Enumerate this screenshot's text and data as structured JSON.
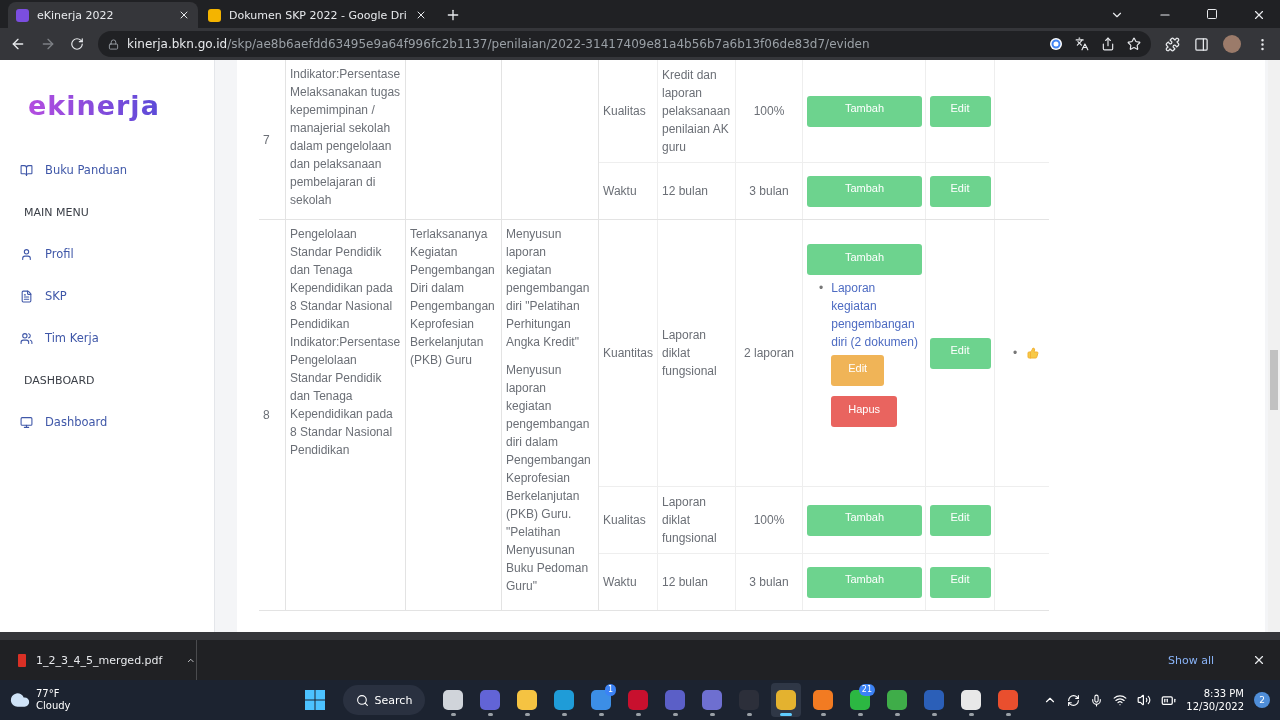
{
  "browser": {
    "tabs": [
      {
        "title": "eKinerja 2022",
        "selected": true
      },
      {
        "title": "Dokumen SKP 2022 - Google Dri",
        "selected": false
      }
    ],
    "url": {
      "host": "kinerja.bkn.go.id",
      "path": "/skp/ae8b6aefdd63495e9a64f996fc2b1137/penilaian/2022-31417409e81a4b56b7a6b13f06de83d7/eviden"
    }
  },
  "sidebar": {
    "logo": "ekinerja",
    "items": [
      {
        "kind": "link",
        "label": "Buku Panduan"
      },
      {
        "kind": "heading",
        "label": "MAIN MENU"
      },
      {
        "kind": "link",
        "label": "Profil"
      },
      {
        "kind": "link",
        "label": "SKP"
      },
      {
        "kind": "link",
        "label": "Tim Kerja"
      },
      {
        "kind": "heading",
        "label": "DASHBOARD"
      },
      {
        "kind": "link",
        "label": "Dashboard"
      }
    ]
  },
  "table": {
    "rows": [
      {
        "no": "7",
        "rencana": "Indikator:Persentase Melaksanakan tugas kepemimpinan / manajerial sekolah dalam pengelolaan dan pelaksanaan pembelajaran di sekolah",
        "indicators": [
          {
            "aspek": "Kualitas",
            "indikator": "Kredit dan laporan pelaksanaan penilaian AK guru",
            "target": "100%",
            "add": "Tambah",
            "edit": "Edit"
          },
          {
            "aspek": "Waktu",
            "indikator": "12 bulan",
            "target": "3 bulan",
            "add": "Tambah",
            "edit": "Edit"
          }
        ]
      },
      {
        "no": "8",
        "rencana": "Pengelolaan Standar Pendidik dan Tenaga Kependidikan pada 8 Standar Nasional Pendidikan Indikator:Persentase Pengelolaan Standar Pendidik dan Tenaga Kependidikan pada 8 Standar Nasional Pendidikan",
        "hasil": "Terlaksananya Kegiatan Pengembangan Diri dalam Pengembangan Keprofesian Berkelanjutan (PKB) Guru",
        "kegiatan": [
          "Menyusun laporan kegiatan pengembangan diri \"Pelatihan Perhitungan Angka Kredit\"",
          "Menyusun laporan kegiatan pengembangan diri dalam Pengembangan Keprofesian Berkelanjutan (PKB) Guru. \"Pelatihan Menyusunan Buku Pedoman Guru\""
        ],
        "indicators": [
          {
            "aspek": "Kuantitas",
            "indikator": "Laporan diklat fungsional",
            "target": "2 laporan",
            "add": "Tambah",
            "edit": "Edit",
            "evidence": [
              {
                "marker": "•",
                "title": "Laporan kegiatan pengembangan diri (2 dokumen)",
                "edit": "Edit",
                "delete": "Hapus"
              }
            ],
            "reactions": [
              {
                "kind": "like",
                "marker": "•"
              }
            ]
          },
          {
            "aspek": "Kualitas",
            "indikator": "Laporan diklat fungsional",
            "target": "100%",
            "add": "Tambah",
            "edit": "Edit"
          },
          {
            "aspek": "Waktu",
            "indikator": "12 bulan",
            "target": "3 bulan",
            "add": "Tambah",
            "edit": "Edit"
          }
        ]
      }
    ]
  },
  "downloads": {
    "file": "1_2_3_4_5_merged.pdf",
    "show_all": "Show all"
  },
  "taskbar": {
    "weather": {
      "temp": "77°F",
      "condition": "Cloudy"
    },
    "search": "Search",
    "apps": [
      {
        "kind": "taskview",
        "selected": false
      },
      {
        "kind": "meet",
        "selected": false
      },
      {
        "kind": "folder",
        "selected": false
      },
      {
        "kind": "edge",
        "selected": false
      },
      {
        "kind": "store",
        "selected": false,
        "badge": "1"
      },
      {
        "kind": "shield",
        "selected": false
      },
      {
        "kind": "teams",
        "selected": false
      },
      {
        "kind": "teams2",
        "selected": false
      },
      {
        "kind": "nox",
        "selected": false
      },
      {
        "kind": "chrome",
        "selected": true
      },
      {
        "kind": "firefox",
        "selected": false
      },
      {
        "kind": "chat",
        "selected": false,
        "badge": "21"
      },
      {
        "kind": "recorder",
        "selected": false
      },
      {
        "kind": "word",
        "selected": false
      },
      {
        "kind": "obs",
        "selected": false
      },
      {
        "kind": "recorder2",
        "selected": false
      }
    ],
    "time": "8:33 PM",
    "date": "12/30/2022",
    "notifications": "2"
  }
}
